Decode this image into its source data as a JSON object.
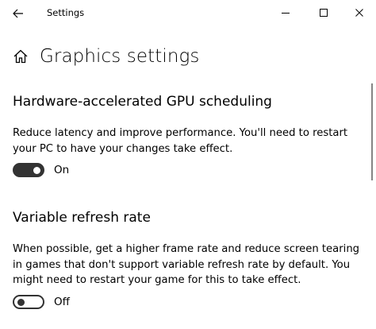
{
  "window": {
    "title": "Settings"
  },
  "page": {
    "title": "Graphics settings"
  },
  "sections": [
    {
      "title": "Hardware-accelerated GPU scheduling",
      "description_lines": [
        "Reduce latency and improve performance. You'll need to restart",
        "your PC to have your changes take effect."
      ],
      "toggle_state": "On",
      "toggle_on": true
    },
    {
      "title": "Variable refresh rate",
      "description_lines": [
        "When possible, get a higher frame rate and reduce screen tearing",
        "in games that don't support variable refresh rate by default. You",
        "might need to restart your game for this to take effect."
      ],
      "toggle_state": "Off",
      "toggle_on": false
    }
  ],
  "icons": {
    "back": "back-arrow-icon",
    "home": "home-icon",
    "minimize": "minimize-icon",
    "maximize": "maximize-icon",
    "close": "close-icon"
  },
  "colors": {
    "background": "#ffffff",
    "toggle_dark": "#333333",
    "text": "#000000"
  }
}
